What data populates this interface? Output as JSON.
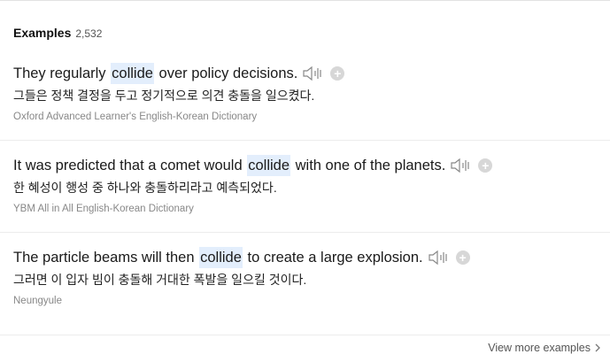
{
  "header": {
    "title": "Examples",
    "count": "2,532"
  },
  "examples": [
    {
      "en_before": "They regularly",
      "en_keyword": "collide",
      "en_after": "over policy decisions.",
      "ko": "그들은 정책 결정을 두고 정기적으로 의견 충돌을 일으켰다.",
      "source": "Oxford Advanced Learner's English-Korean Dictionary"
    },
    {
      "en_before": "It was predicted that a comet would",
      "en_keyword": "collide",
      "en_after": "with one of the planets.",
      "ko": "한 혜성이 행성 중 하나와 충돌하리라고 예측되었다.",
      "source": "YBM All in All English-Korean Dictionary"
    },
    {
      "en_before": "The particle beams will then",
      "en_keyword": "collide",
      "en_after": "to create a large explosion.",
      "ko": "그러면 이 입자 빔이 충돌해 거대한 폭발을 일으킬 것이다.",
      "source": "Neungyule"
    }
  ],
  "footer": {
    "more_label": "View more examples"
  },
  "icons": {
    "speaker": "speaker-icon",
    "add": "plus-circle-icon",
    "more": "chevron-right-icon"
  },
  "colors": {
    "highlight": "#e3eefc",
    "source_text": "#888888"
  }
}
